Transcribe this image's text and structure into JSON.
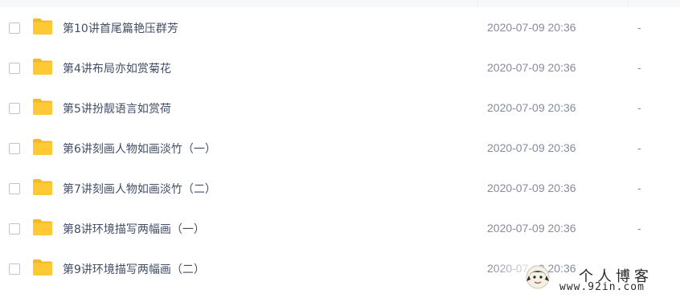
{
  "file_list": {
    "rows": [
      {
        "name": "第10讲首尾篇艳压群芳",
        "modified": "2020-07-09 20:36",
        "size": "-"
      },
      {
        "name": "第4讲布局亦如赏菊花",
        "modified": "2020-07-09 20:36",
        "size": "-"
      },
      {
        "name": "第5讲扮靓语言如赏荷",
        "modified": "2020-07-09 20:36",
        "size": "-"
      },
      {
        "name": "第6讲刻画人物如画淡竹（一）",
        "modified": "2020-07-09 20:36",
        "size": "-"
      },
      {
        "name": "第7讲刻画人物如画淡竹（二）",
        "modified": "2020-07-09 20:36",
        "size": "-"
      },
      {
        "name": "第8讲环境描写两幅画（一）",
        "modified": "2020-07-09 20:36",
        "size": "-"
      },
      {
        "name": "第9讲环境描写两幅画（二）",
        "modified": "2020-07-09 20:36",
        "size": "-"
      }
    ],
    "folder_icon": "folder-icon",
    "folder_color": "#ffc935",
    "folder_tab_color": "#f5b82a"
  },
  "watermark": {
    "title": "个人博客",
    "url": "www.92in.com"
  }
}
